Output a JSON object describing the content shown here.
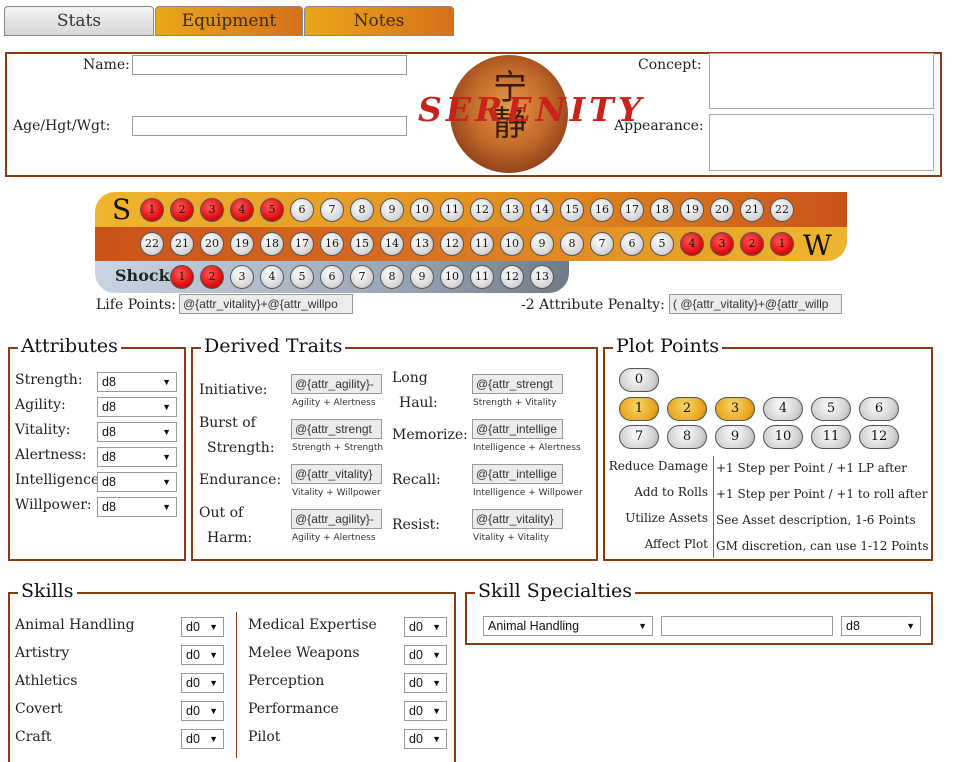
{
  "tabs": [
    {
      "label": "Stats",
      "active": true
    },
    {
      "label": "Equipment",
      "active": false
    },
    {
      "label": "Notes",
      "active": false
    }
  ],
  "header": {
    "name_label": "Name:",
    "age_label": "Age/Hgt/Wgt:",
    "concept_label": "Concept:",
    "appearance_label": "Appearance:",
    "logo_text": "SERENITY",
    "logo_glyph": "宁\n静",
    "name_value": "",
    "age_value": "",
    "concept_value": "",
    "appearance_value": ""
  },
  "track": {
    "stun_letter": "S",
    "wound_letter": "W",
    "shock_label": "Shock",
    "stun_row": [
      "1",
      "2",
      "3",
      "4",
      "5",
      "6",
      "7",
      "8",
      "9",
      "10",
      "11",
      "12",
      "13",
      "14",
      "15",
      "16",
      "17",
      "18",
      "19",
      "20",
      "21",
      "22"
    ],
    "stun_red_count": 5,
    "wound_row": [
      "22",
      "21",
      "20",
      "19",
      "18",
      "17",
      "16",
      "15",
      "14",
      "13",
      "12",
      "11",
      "10",
      "9",
      "8",
      "7",
      "6",
      "5",
      "4",
      "3",
      "2",
      "1"
    ],
    "wound_red_from_index": 18,
    "shock_row": [
      "1",
      "2",
      "3",
      "4",
      "5",
      "6",
      "7",
      "8",
      "9",
      "10",
      "11",
      "12",
      "13"
    ],
    "shock_red_count": 2,
    "life_points_label": "Life Points:",
    "life_points_value": "@{attr_vitality}+@{attr_willpo",
    "penalty_label": "-2 Attribute Penalty:",
    "penalty_value": "( @{attr_vitality}+@{attr_willp"
  },
  "attributes": {
    "legend": "Attributes",
    "items": [
      {
        "label": "Strength:",
        "value": "d8"
      },
      {
        "label": "Agility:",
        "value": "d8"
      },
      {
        "label": "Vitality:",
        "value": "d8"
      },
      {
        "label": "Alertness:",
        "value": "d8"
      },
      {
        "label": "Intelligence:",
        "value": "d8"
      },
      {
        "label": "Willpower:",
        "value": "d8"
      }
    ]
  },
  "derived": {
    "legend": "Derived Traits",
    "items": [
      {
        "label1": "Initiative:",
        "label2": "",
        "value": "@{attr_agility}-",
        "hint": "Agility + Alertness"
      },
      {
        "label1": "Burst of",
        "label2": "Strength:",
        "value": "@{attr_strengt",
        "hint": "Strength + Strength"
      },
      {
        "label1": "Endurance:",
        "label2": "",
        "value": "@{attr_vitality}",
        "hint": "Vitality + Willpower"
      },
      {
        "label1": "Out of",
        "label2": "Harm:",
        "value": "@{attr_agility}-",
        "hint": "Agility + Alertness"
      },
      {
        "label1": "Long",
        "label2": "Haul:",
        "value": "@{attr_strengt",
        "hint": "Strength + Vitality"
      },
      {
        "label1": "Memorize:",
        "label2": "",
        "value": "@{attr_intellige",
        "hint": "Intelligence + Alertness"
      },
      {
        "label1": "Recall:",
        "label2": "",
        "value": "@{attr_intellige",
        "hint": "Intelligence + Willpower"
      },
      {
        "label1": "Resist:",
        "label2": "",
        "value": "@{attr_vitality}",
        "hint": "Vitality + Vitality"
      }
    ]
  },
  "plot_points": {
    "legend": "Plot Points",
    "values": [
      "0",
      "1",
      "2",
      "3",
      "4",
      "5",
      "6",
      "7",
      "8",
      "9",
      "10",
      "11",
      "12"
    ],
    "gold": [
      "1",
      "2",
      "3"
    ],
    "rules": [
      {
        "label": "Reduce Damage",
        "desc": "+1 Step per Point / +1 LP after"
      },
      {
        "label": "Add to Rolls",
        "desc": "+1 Step per Point / +1 to roll after"
      },
      {
        "label": "Utilize Assets",
        "desc": "See Asset description, 1-6 Points"
      },
      {
        "label": "Affect Plot",
        "desc": "GM discretion, can use 1-12 Points"
      }
    ]
  },
  "skills": {
    "legend": "Skills",
    "left": [
      {
        "label": "Animal Handling",
        "value": "d0"
      },
      {
        "label": "Artistry",
        "value": "d0"
      },
      {
        "label": "Athletics",
        "value": "d0"
      },
      {
        "label": "Covert",
        "value": "d0"
      },
      {
        "label": "Craft",
        "value": "d0"
      }
    ],
    "right": [
      {
        "label": "Medical Expertise",
        "value": "d0"
      },
      {
        "label": "Melee Weapons",
        "value": "d0"
      },
      {
        "label": "Perception",
        "value": "d0"
      },
      {
        "label": "Performance",
        "value": "d0"
      },
      {
        "label": "Pilot",
        "value": "d0"
      }
    ]
  },
  "specialties": {
    "legend": "Skill Specialties",
    "skill_value": "Animal Handling",
    "text_value": "",
    "die_value": "d8"
  },
  "colors": {
    "frame": "#8b3a14",
    "gold": "#e8a51c",
    "red_pip": "#e30f0f",
    "tab_orange": "#d8701a"
  }
}
